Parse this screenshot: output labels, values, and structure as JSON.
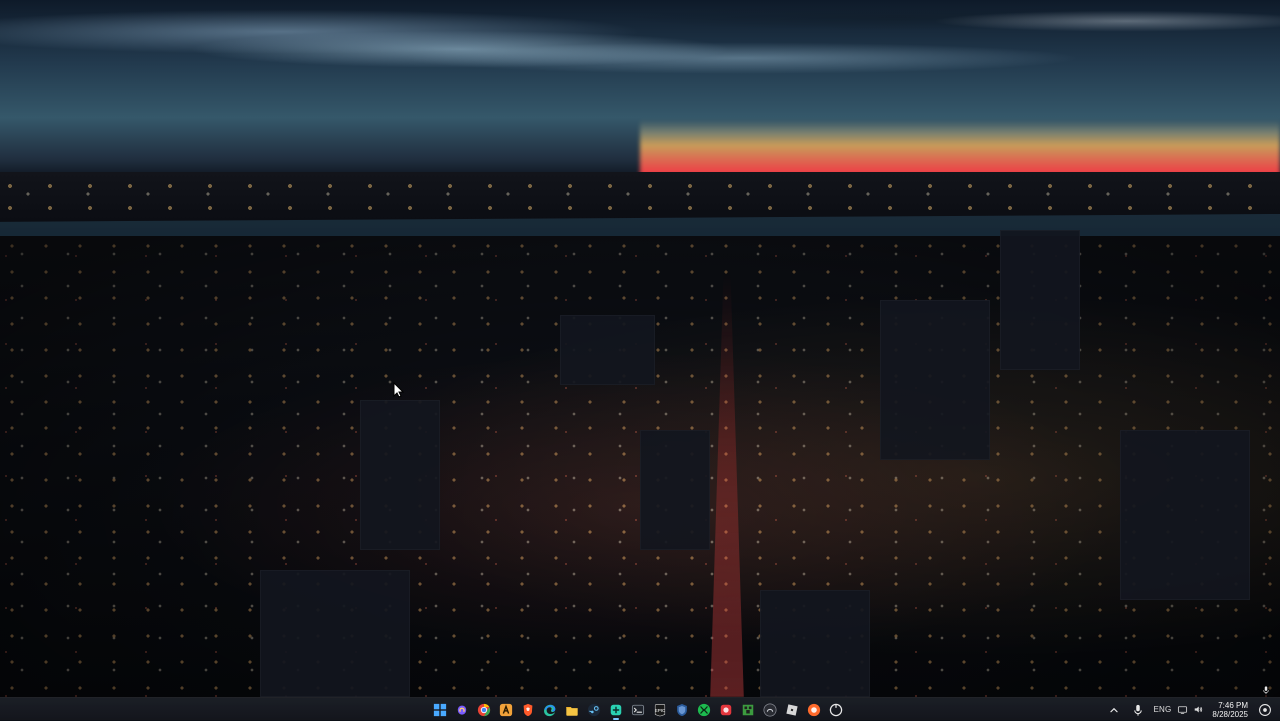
{
  "desktop": {
    "wallpaper_name": "city-night-wallpaper"
  },
  "taskbar": {
    "apps": [
      {
        "name": "windows-start",
        "label": "Start"
      },
      {
        "name": "copilot",
        "label": "Copilot"
      },
      {
        "name": "chrome",
        "label": "Chrome"
      },
      {
        "name": "app-a",
        "label": "A"
      },
      {
        "name": "brave",
        "label": "Brave"
      },
      {
        "name": "edge",
        "label": "Edge"
      },
      {
        "name": "file-explorer",
        "label": "File Explorer"
      },
      {
        "name": "steam",
        "label": "Steam"
      },
      {
        "name": "active-app",
        "label": "App"
      },
      {
        "name": "terminal",
        "label": "Terminal"
      },
      {
        "name": "epic-games",
        "label": "EPIC"
      },
      {
        "name": "shield",
        "label": "Shield"
      },
      {
        "name": "xbox",
        "label": "Xbox"
      },
      {
        "name": "red-app",
        "label": "Red"
      },
      {
        "name": "minecraft",
        "label": "Minecraft"
      },
      {
        "name": "dark-app",
        "label": "Dark"
      },
      {
        "name": "roblox",
        "label": "Roblox"
      },
      {
        "name": "orange-app",
        "label": "Orange"
      },
      {
        "name": "circle-app",
        "label": "Circle"
      }
    ],
    "tray": {
      "language": "ENG",
      "time": "7:46 PM",
      "date": "8/28/2025"
    }
  }
}
